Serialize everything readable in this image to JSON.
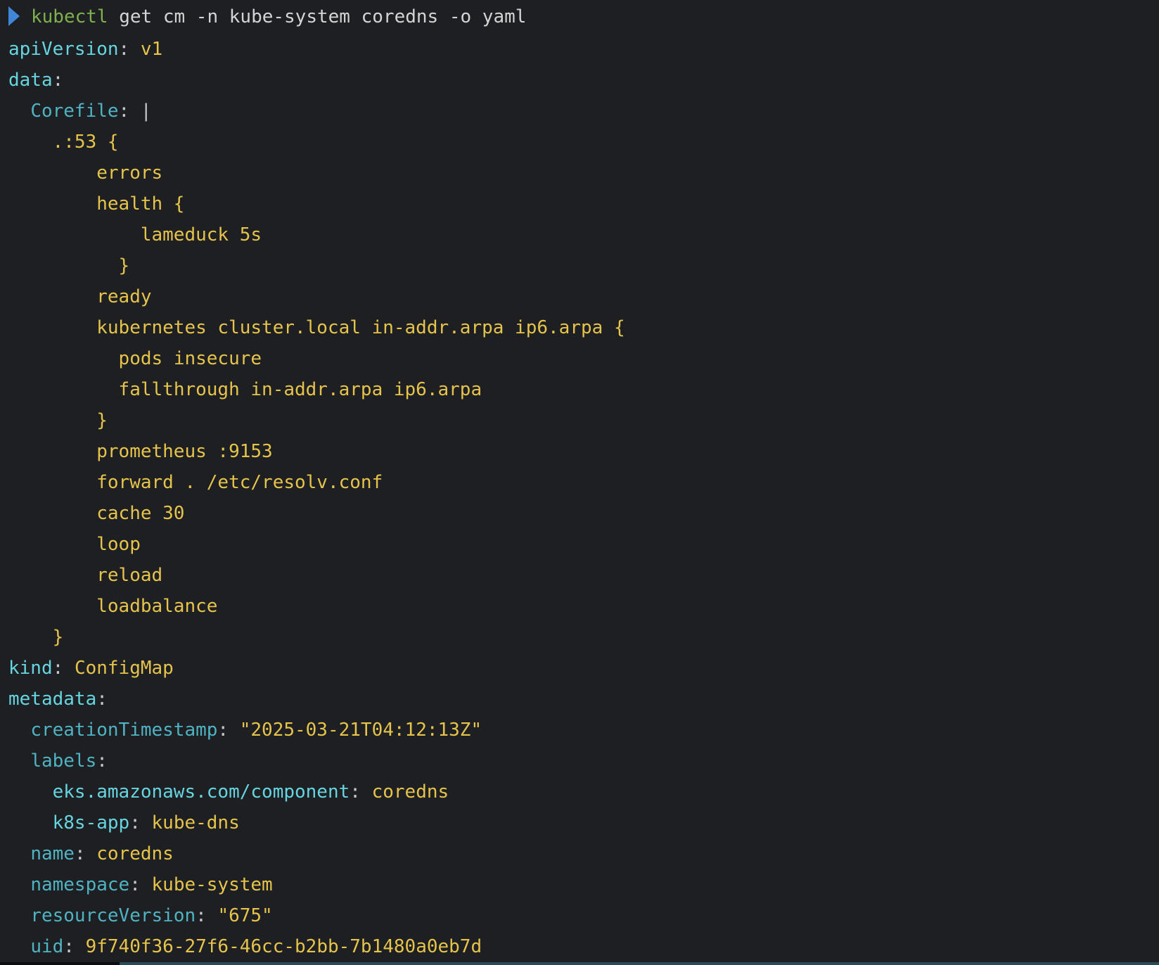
{
  "prompt": {
    "command": "kubectl",
    "args": " get cm -n kube-system coredns -o yaml"
  },
  "yaml": {
    "apiVersion_key": "apiVersion",
    "apiVersion_val": "v1",
    "data_key": "data",
    "corefile_key": "Corefile",
    "corefile_indicator": "|",
    "corefile_lines": [
      ".:53 {",
      "errors",
      "health {",
      "lameduck 5s",
      "}",
      "ready",
      "kubernetes cluster.local in-addr.arpa ip6.arpa {",
      "pods insecure",
      "fallthrough in-addr.arpa ip6.arpa",
      "}",
      "prometheus :9153",
      "forward . /etc/resolv.conf",
      "cache 30",
      "loop",
      "reload",
      "loadbalance",
      "}"
    ],
    "kind_key": "kind",
    "kind_val": "ConfigMap",
    "metadata_key": "metadata",
    "creationTimestamp_key": "creationTimestamp",
    "creationTimestamp_val": "\"2025-03-21T04:12:13Z\"",
    "labels_key": "labels",
    "label_component_key": "eks.amazonaws.com/component",
    "label_component_val": "coredns",
    "label_k8sapp_key": "k8s-app",
    "label_k8sapp_val": "kube-dns",
    "name_key": "name",
    "name_val": "coredns",
    "namespace_key": "namespace",
    "namespace_val": "kube-system",
    "resourceVersion_key": "resourceVersion",
    "resourceVersion_val": "\"675\"",
    "uid_key": "uid",
    "uid_val": "9f740f36-27f6-46cc-b2bb-7b1480a0eb7d"
  },
  "colors": {
    "background": "#1d1f23",
    "prompt_arrow": "#3f86d6",
    "command": "#7eb04e",
    "top_key": "#66d5e0",
    "nested_key": "#4fb3c2",
    "value": "#e6c34a"
  }
}
